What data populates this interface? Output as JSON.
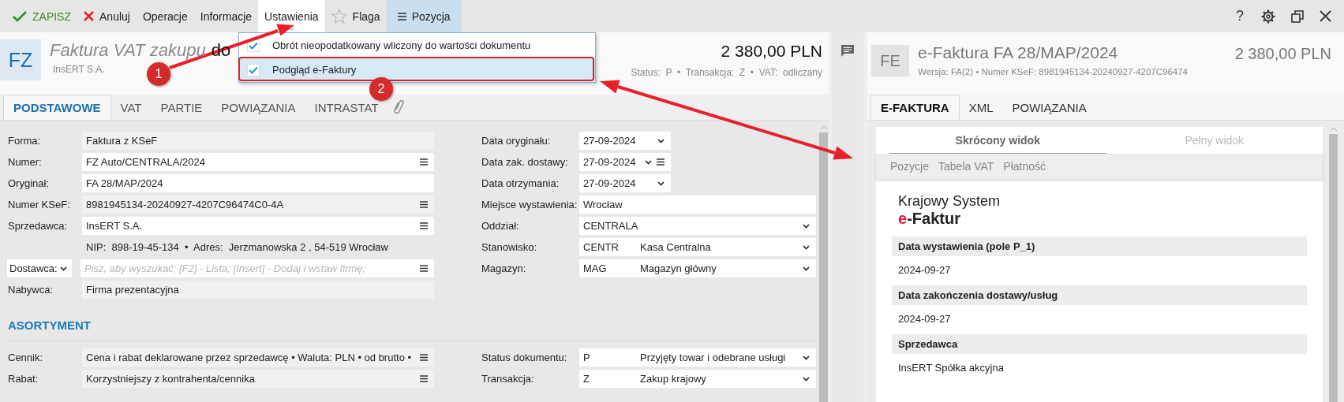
{
  "toolbar": {
    "items": [
      {
        "kind": "save",
        "label": "ZAPISZ",
        "selected": false
      },
      {
        "kind": "cancel",
        "label": "Anuluj",
        "selected": false
      },
      {
        "kind": "menu",
        "label": "Operacje",
        "selected": false
      },
      {
        "kind": "menu",
        "label": "Informacje",
        "selected": false
      },
      {
        "kind": "menu",
        "label": "Ustawienia",
        "selected": true
      },
      {
        "kind": "flag",
        "label": "Flaga",
        "selected": false
      },
      {
        "kind": "pane",
        "label": "Pozycja",
        "selected": true
      }
    ],
    "help_label": "?"
  },
  "settings_menu": {
    "items": [
      {
        "label": "Obrót nieopodatkowany wliczony do wartości dokumentu",
        "checked": true,
        "selected": false
      },
      {
        "label": "Podgląd e-Faktury",
        "checked": true,
        "selected": true
      }
    ]
  },
  "document": {
    "badge": "FZ",
    "title_type": "Faktura VAT zakupu",
    "title_rest": "do",
    "subtitle": "InsERT S.A.",
    "amount": "2 380,00 PLN",
    "status_line": "Status:  P  •  Transakcja:  Z  •  VAT:  odliczany",
    "tabs": [
      {
        "label": "PODSTAWOWE",
        "selected": true
      },
      {
        "label": "VAT",
        "selected": false
      },
      {
        "label": "PARTIE",
        "selected": false
      },
      {
        "label": "POWIĄZANIA",
        "selected": false
      },
      {
        "label": "INTRASTAT",
        "selected": false
      }
    ],
    "basic_left": [
      {
        "kind": "field",
        "label": "Forma:",
        "value": "Faktura z KSeF",
        "readonly": true,
        "menu": false
      },
      {
        "kind": "field",
        "label": "Numer:",
        "value": "FZ Auto/CENTRALA/2024",
        "readonly": false,
        "menu": true
      },
      {
        "kind": "field",
        "label": "Oryginał:",
        "value": "FA 28/MAP/2024",
        "readonly": false,
        "menu": false
      },
      {
        "kind": "field",
        "label": "Numer KSeF:",
        "value": "8981945134-20240927-4207C96474C0-4A",
        "readonly": true,
        "menu": true
      },
      {
        "kind": "field",
        "label": "Sprzedawca:",
        "value": "InsERT S.A.",
        "readonly": false,
        "menu": true
      },
      {
        "kind": "note",
        "text": "NIP:  898-19-45-134  •  Adres:  Jerzmanowska 2 , 54-519 Wrocław"
      },
      {
        "kind": "lookup",
        "label": "Dostawca:",
        "placeholder": "Pisz, aby wyszukać; [F2] - Lista; [Insert] - Dodaj i wstaw firmę;",
        "menu": true
      },
      {
        "kind": "field",
        "label": "Nabywca:",
        "value": "Firma prezentacyjna",
        "readonly": true,
        "menu": false
      }
    ],
    "basic_right": [
      {
        "kind": "date",
        "label": "Data oryginału:",
        "value": "27-09-2024",
        "menu": false
      },
      {
        "kind": "date",
        "label": "Data zak. dostawy:",
        "value": "27-09-2024",
        "menu": true
      },
      {
        "kind": "date",
        "label": "Data otrzymania:",
        "value": "27-09-2024",
        "menu": false
      },
      {
        "kind": "text",
        "label": "Miejsce wystawienia:",
        "value": "Wrocław"
      },
      {
        "kind": "select",
        "label": "Oddział:",
        "value": "CENTRALA"
      },
      {
        "kind": "select",
        "label": "Stanowisko:",
        "code": "CENTR",
        "value": "Kasa Centralna"
      },
      {
        "kind": "select",
        "label": "Magazyn:",
        "code": "MAG",
        "value": "Magazyn główny"
      }
    ],
    "section_title": "ASORTYMENT",
    "assort_left": [
      {
        "kind": "field",
        "label": "Cennik:",
        "value": "Cena i rabat deklarowane przez sprzedawcę • Waluta: PLN • od brutto •",
        "readonly": true,
        "menu": true
      },
      {
        "kind": "field",
        "label": "Rabat:",
        "value": "Korzystniejszy z kontrahenta/cennika",
        "readonly": true,
        "menu": true
      }
    ],
    "assort_right": [
      {
        "kind": "select",
        "label": "Status dokumentu:",
        "code": "P",
        "value": "Przyjęty towar i odebrane usługi"
      },
      {
        "kind": "select",
        "label": "Transakcja:",
        "code": "Z",
        "value": "Zakup krajowy"
      }
    ]
  },
  "preview": {
    "badge": "FE",
    "title": "e-Faktura FA 28/MAP/2024",
    "subtitle": "Wersja: FA(2) • Numer KSeF: 8981945134-20240927-4207C96474",
    "amount": "2 380,00 PLN",
    "tabs": [
      {
        "label": "E-FAKTURA",
        "selected": true
      },
      {
        "label": "XML",
        "selected": false
      },
      {
        "label": "POWIĄZANIA",
        "selected": false
      }
    ],
    "views": [
      {
        "label": "Skrócony widok",
        "selected": true
      },
      {
        "label": "Pełny widok",
        "selected": false
      }
    ],
    "links": [
      "Pozycje",
      "Tabela VAT",
      "Płatność"
    ],
    "logo_line1": "Krajowy System",
    "logo_accent": "e",
    "logo_rest": "-Faktur",
    "sections": [
      {
        "title": "Data wystawienia (pole P_1)",
        "lines": [
          "2024-09-27"
        ]
      },
      {
        "title": "Data zakończenia dostawy/usług",
        "lines": [
          "2024-09-27"
        ]
      },
      {
        "title": "Sprzedawca",
        "lines": [
          "InsERT Spółka akcyjna"
        ]
      }
    ]
  },
  "annotations": {
    "markers": [
      "1",
      "2"
    ]
  }
}
